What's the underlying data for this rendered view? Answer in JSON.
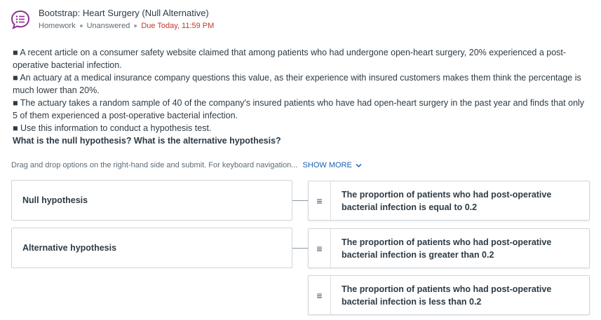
{
  "header": {
    "title": "Bootstrap: Heart Surgery (Null Alternative)",
    "type": "Homework",
    "status": "Unanswered",
    "due": "Due Today, 11:59 PM",
    "icon": "chat-list-icon"
  },
  "question": {
    "bullets": [
      "■ A recent article on a consumer safety website claimed that among patients who had undergone open-heart surgery, 20% experienced a post-operative bacterial infection.",
      "■ An actuary at a medical insurance company questions this value, as their experience with insured customers makes them think the percentage is much lower than 20%.",
      "■ The actuary takes a random sample of 40 of the company's insured patients who have had open-heart surgery in the past year and finds that only 5 of them experienced a post-operative bacterial infection.",
      "■ Use this information to conduct a hypothesis test."
    ],
    "prompt": "What is the null hypothesis? What is the alternative hypothesis?"
  },
  "instructions": {
    "text": "Drag and drop options on the right-hand side and submit. For keyboard navigation...",
    "show_more": "SHOW MORE"
  },
  "targets": [
    {
      "label": "Null hypothesis"
    },
    {
      "label": "Alternative hypothesis"
    }
  ],
  "options": [
    {
      "text": "The proportion of patients who had post-operative bacterial infection is equal to 0.2"
    },
    {
      "text": "The proportion of patients who had post-operative bacterial infection is greater than 0.2"
    },
    {
      "text": "The proportion of patients who had post-operative bacterial infection is less than 0.2"
    }
  ],
  "colors": {
    "accent_purple": "#8e2e8f",
    "due_red": "#c0392b",
    "link_blue": "#1a5fb4"
  }
}
